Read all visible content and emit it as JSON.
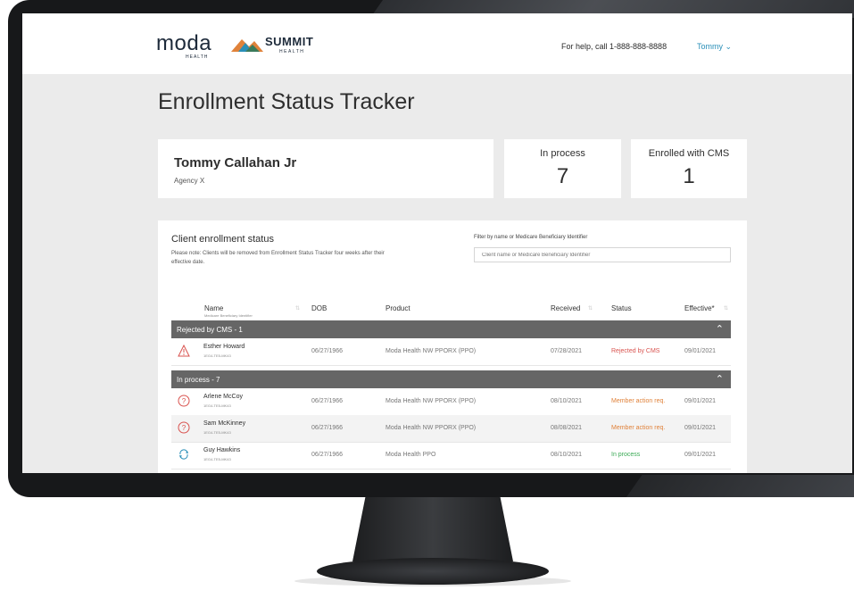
{
  "header": {
    "logo_moda": "moda",
    "logo_moda_sub": "HEALTH",
    "logo_summit": "SUMMIT",
    "logo_summit_sub": "HEALTH",
    "help_text": "For help, call 1-888-888-8888",
    "user_menu": "Tommy ⌄"
  },
  "page_title": "Enrollment Status Tracker",
  "agent": {
    "name": "Tommy Callahan Jr",
    "agency": "Agency X"
  },
  "stats": [
    {
      "label": "In process",
      "value": "7"
    },
    {
      "label": "Enrolled with CMS",
      "value": "1"
    }
  ],
  "panel": {
    "title": "Client enrollment status",
    "note": "Please note: Clients will be removed from Enrollment Status Tracker four weeks after their effective date.",
    "filter_label": "Filter by name or Medicare Beneficiary Identifier",
    "filter_placeholder": "Client name or Medicare Beneficiary Identifier"
  },
  "columns": {
    "name": "Name",
    "name_sub": "Medicare Beneficiary Identifier",
    "dob": "DOB",
    "product": "Product",
    "received": "Received",
    "status": "Status",
    "effective": "Effective*"
  },
  "groups": [
    {
      "label": "Rejected by CMS - 1"
    },
    {
      "label": "In process - 7"
    }
  ],
  "rows": [
    {
      "icon": "warning-icon",
      "name": "Esther Howard",
      "id": "1EG4-TE5-MK43",
      "dob": "06/27/1966",
      "product": "Moda Health NW PPORX (PPO)",
      "received": "07/28/2021",
      "status": "Rejected by CMS",
      "effective": "09/01/2021"
    },
    {
      "icon": "question-icon",
      "name": "Arlene McCoy",
      "id": "1EG4-TE5-MK43",
      "dob": "06/27/1966",
      "product": "Moda Health NW PPORX (PPO)",
      "received": "08/10/2021",
      "status": "Member action req.",
      "effective": "09/01/2021"
    },
    {
      "icon": "question-icon",
      "name": "Sam McKinney",
      "id": "1EG4-TE5-MK43",
      "dob": "06/27/1966",
      "product": "Moda Health NW PPORX (PPO)",
      "received": "08/08/2021",
      "status": "Member action req.",
      "effective": "09/01/2021"
    },
    {
      "icon": "in-process-icon",
      "name": "Guy Hawkins",
      "id": "1EG4-TE5-MK43",
      "dob": "06/27/1966",
      "product": "Moda Health PPO",
      "received": "08/10/2021",
      "status": "In process",
      "effective": "09/01/2021"
    }
  ],
  "colors": {
    "accent": "#2a8fb8",
    "rejected": "#d9534f",
    "action_required": "#e0823a",
    "in_process": "#3aaa55",
    "group_header": "#666666"
  }
}
